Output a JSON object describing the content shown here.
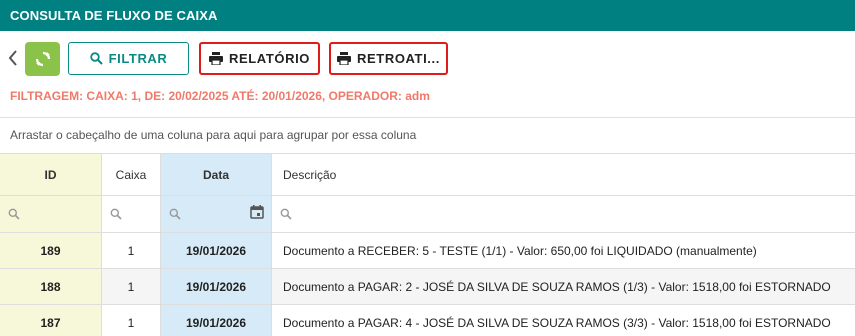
{
  "header": {
    "title": "CONSULTA DE FLUXO DE CAIXA"
  },
  "toolbar": {
    "filtrar_label": "FILTRAR",
    "relatorio_label": "RELATÓRIO",
    "retroativo_label": "RETROATI..."
  },
  "filter_info": "FILTRAGEM: CAIXA: 1, DE: 20/02/2025 ATÉ: 20/01/2026, OPERADOR: adm",
  "group_panel": "Arrastar o cabeçalho de uma coluna para aqui para agrupar por essa coluna",
  "columns": {
    "id": "ID",
    "caixa": "Caixa",
    "data": "Data",
    "descricao": "Descrição"
  },
  "rows": [
    {
      "id": "189",
      "caixa": "1",
      "data": "19/01/2026",
      "descricao": "Documento a RECEBER: 5 - TESTE (1/1) - Valor: 650,00 foi LIQUIDADO (manualmente)"
    },
    {
      "id": "188",
      "caixa": "1",
      "data": "19/01/2026",
      "descricao": "Documento a PAGAR: 2 - JOSÉ DA SILVA DE SOUZA RAMOS (1/3) - Valor: 1518,00 foi ESTORNADO"
    },
    {
      "id": "187",
      "caixa": "1",
      "data": "19/01/2026",
      "descricao": "Documento a PAGAR: 4 - JOSÉ DA SILVA DE SOUZA RAMOS (3/3) - Valor: 1518,00 foi ESTORNADO"
    }
  ],
  "colors": {
    "header_bg": "#008080",
    "accent_teal": "#0a8a83",
    "refresh_green": "#8bc34a",
    "filter_text": "#f07a6a",
    "highlight_border": "#e01b1b",
    "id_col_bg": "#f7f7d9",
    "date_col_bg": "#d6eaf7"
  }
}
